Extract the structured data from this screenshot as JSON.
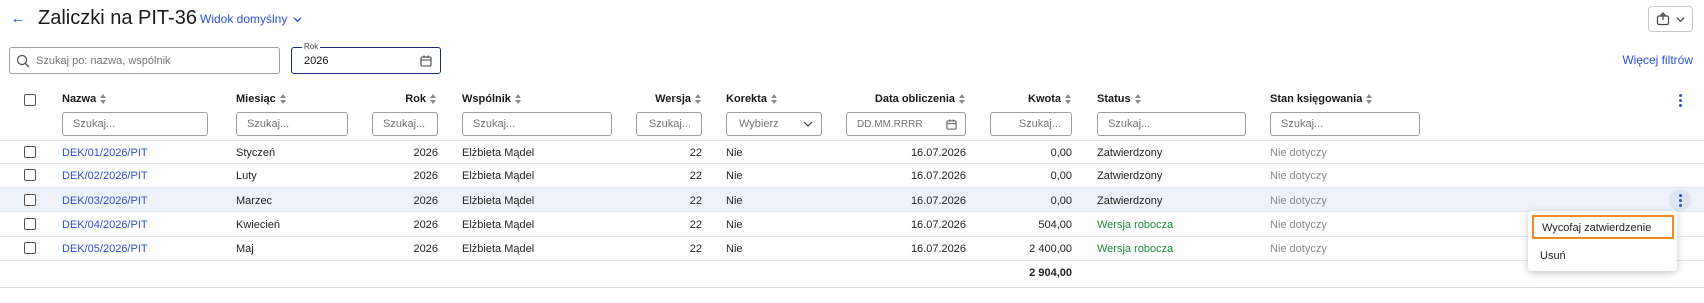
{
  "header": {
    "title": "Zaliczki na PIT-36",
    "view_label": "Widok domyślny",
    "back_icon": "arrow-left-icon",
    "export_icon": "export-icon"
  },
  "filters": {
    "search_placeholder": "Szukaj po: nazwa, wspólnik",
    "year_label": "Rok",
    "year_value": "2026",
    "more_filters": "Więcej filtrów"
  },
  "table": {
    "columns": {
      "nazwa": "Nazwa",
      "miesiac": "Miesiąc",
      "rok": "Rok",
      "wspolnik": "Wspólnik",
      "wersja": "Wersja",
      "korekta": "Korekta",
      "data": "Data obliczenia",
      "kwota": "Kwota",
      "status": "Status",
      "stan": "Stan księgowania"
    },
    "filter_placeholders": {
      "text": "Szukaj...",
      "select": "Wybierz",
      "date": "DD.MM.RRRR"
    },
    "rows": [
      {
        "nazwa": "DEK/01/2026/PIT",
        "miesiac": "Styczeń",
        "rok": "2026",
        "wspolnik": "Elżbieta Mądel",
        "wersja": "22",
        "korekta": "Nie",
        "data": "16.07.2026",
        "kwota": "0,00",
        "status": "Zatwierdzony",
        "stan": "Nie dotyczy"
      },
      {
        "nazwa": "DEK/02/2026/PIT",
        "miesiac": "Luty",
        "rok": "2026",
        "wspolnik": "Elżbieta Mądel",
        "wersja": "22",
        "korekta": "Nie",
        "data": "16.07.2026",
        "kwota": "0,00",
        "status": "Zatwierdzony",
        "stan": "Nie dotyczy"
      },
      {
        "nazwa": "DEK/03/2026/PIT",
        "miesiac": "Marzec",
        "rok": "2026",
        "wspolnik": "Elżbieta Mądel",
        "wersja": "22",
        "korekta": "Nie",
        "data": "16.07.2026",
        "kwota": "0,00",
        "status": "Zatwierdzony",
        "stan": "Nie dotyczy"
      },
      {
        "nazwa": "DEK/04/2026/PIT",
        "miesiac": "Kwiecień",
        "rok": "2026",
        "wspolnik": "Elżbieta Mądel",
        "wersja": "22",
        "korekta": "Nie",
        "data": "16.07.2026",
        "kwota": "504,00",
        "status": "Wersja robocza",
        "stan": "Nie dotyczy"
      },
      {
        "nazwa": "DEK/05/2026/PIT",
        "miesiac": "Maj",
        "rok": "2026",
        "wspolnik": "Elżbieta Mądel",
        "wersja": "22",
        "korekta": "Nie",
        "data": "16.07.2026",
        "kwota": "2 400,00",
        "status": "Wersja robocza",
        "stan": "Nie dotyczy"
      }
    ],
    "total_kwota": "2 904,00"
  },
  "context_menu": {
    "items": [
      "Wycofaj zatwierdzenie",
      "Usuń"
    ]
  },
  "colors": {
    "accent": "#2b50d6",
    "status_draft": "#1e8a3a",
    "highlight_border": "#f08a24",
    "selected_row": "#eef2fa"
  }
}
